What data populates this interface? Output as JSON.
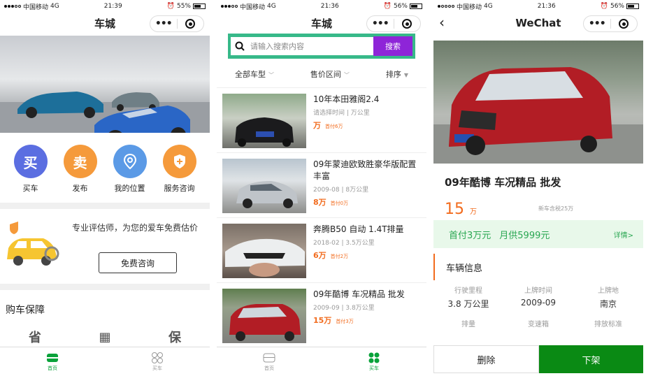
{
  "status": {
    "p1": {
      "carrier": "中国移动",
      "net": "4G",
      "time": "21:39",
      "battery": "55%",
      "battery_level": 0.55
    },
    "p2": {
      "carrier": "中国移动",
      "net": "4G",
      "time": "21:36",
      "battery": "56%",
      "battery_level": 0.56
    },
    "p3": {
      "carrier": "中国移动",
      "net": "4G",
      "time": "21:36",
      "battery": "56%",
      "battery_level": 0.56
    }
  },
  "home": {
    "title": "车城",
    "grid": [
      {
        "glyph": "买",
        "label": "买车",
        "color": "#5b6ee1"
      },
      {
        "glyph": "卖",
        "label": "发布",
        "color": "#f59a3b"
      },
      {
        "glyph": "⌖",
        "label": "我的位置",
        "color": "#5b9ae6"
      },
      {
        "glyph": "✚",
        "label": "服务咨询",
        "color": "#f59a3b"
      }
    ],
    "eval_text": "专业评估师，为您的爱车免费估价",
    "eval_button": "免费咨询",
    "section_title": "购车保障",
    "guarantee_glyphs": [
      "省",
      "",
      "保"
    ],
    "tabs": [
      {
        "label": "首页",
        "active": true
      },
      {
        "label": "买车",
        "active": false
      }
    ]
  },
  "listpage": {
    "title": "车城",
    "search_placeholder": "请输入搜索内容",
    "search_button": "搜索",
    "filters": [
      "全部车型",
      "售价区间",
      "排序"
    ],
    "items": [
      {
        "title": "10年本田雅阁2.4",
        "meta": "请选择时间 | 万公里",
        "price": "万",
        "down": "首付6万",
        "plate": "苏A·B·Y963"
      },
      {
        "title": "09年蒙迪欧致胜豪华版配置丰富",
        "meta": "2009-08 | 8万公里",
        "price": "8万",
        "down": "首付0万",
        "plate": ""
      },
      {
        "title": "奔腾B50 自动 1.4T排量",
        "meta": "2018-02 | 3.5万公里",
        "price": "6万",
        "down": "首付2万",
        "plate": ""
      },
      {
        "title": "09年酷博 车况精品 批发",
        "meta": "2009-09 | 3.8万公里",
        "price": "15万",
        "down": "首付3万",
        "plate": ""
      }
    ],
    "tabs": [
      {
        "label": "首页",
        "active": false
      },
      {
        "label": "买车",
        "active": true
      }
    ]
  },
  "detail": {
    "title": "WeChat",
    "car_title": "09年酷博 车况精品 批发",
    "price": "15",
    "price_unit": "万",
    "new_price": "新车含税25万",
    "down_payment": "首付3万元",
    "monthly": "月供5999元",
    "more": "详情>",
    "info_title": "车辆信息",
    "specs": [
      {
        "label": "行驶里程",
        "value": "3.8 万公里"
      },
      {
        "label": "上牌时间",
        "value": "2009-09"
      },
      {
        "label": "上牌地",
        "value": "南京"
      },
      {
        "label": "排量",
        "value": ""
      },
      {
        "label": "变速箱",
        "value": ""
      },
      {
        "label": "排放标准",
        "value": ""
      }
    ],
    "delete_button": "删除",
    "offline_button": "下架"
  }
}
